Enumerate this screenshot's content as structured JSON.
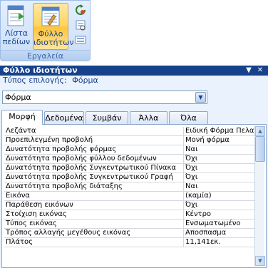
{
  "ribbon": {
    "list_button_label": "Λίστα πεδίων",
    "sheet_button_label": "Φύλλο ιδιοτήτων",
    "group_label": "Εργαλεία"
  },
  "panel": {
    "title": "Φύλλο ιδιοτήτων",
    "selection_type_label": "Τύπος επιλογής:",
    "selection_type_value": "Φόρμα",
    "object_combo_value": "Φόρμα",
    "tabs": [
      {
        "label": "Μορφή",
        "active": true
      },
      {
        "label": "Δεδομένα",
        "active": false
      },
      {
        "label": "Συμβάν",
        "active": false
      },
      {
        "label": "Άλλα",
        "active": false
      },
      {
        "label": "Όλα",
        "active": false
      }
    ],
    "properties": [
      {
        "name": "Λεζάντα",
        "value": "Ειδική Φόρμα Πελα"
      },
      {
        "name": "Προεπιλεγμένη προβολή",
        "value": "Μονή φόρμα"
      },
      {
        "name": "Δυνατότητα προβολής φόρμας",
        "value": "Ναι"
      },
      {
        "name": "Δυνατότητα προβολής φύλλου δεδομένων",
        "value": "Όχι"
      },
      {
        "name": "Δυνατότητα προβολής Συγκεντρωτικού Πίνακα",
        "value": "Όχι"
      },
      {
        "name": "Δυνατότητα προβολής Συγκεντρωτικού Γραφή",
        "value": "Όχι"
      },
      {
        "name": "Δυνατότητα προβολής διάταξης",
        "value": "Ναι"
      },
      {
        "name": "Εικόνα",
        "value": "(καμία)"
      },
      {
        "name": "Παράθεση εικόνων",
        "value": "Όχι"
      },
      {
        "name": "Στοίχιση εικόνας",
        "value": "Κέντρο"
      },
      {
        "name": "Τύπος εικόνας",
        "value": "Ενσωματωμένο"
      },
      {
        "name": "Τρόπος αλλαγής μεγέθους εικόνας",
        "value": "Αποσπασμα"
      },
      {
        "name": "Πλάτος",
        "value": "11,141εκ."
      }
    ]
  },
  "colors": {
    "titlebar": "#15428b",
    "panel_bg": "#eaf2fd",
    "ribbon_active": "#ffd35a"
  }
}
